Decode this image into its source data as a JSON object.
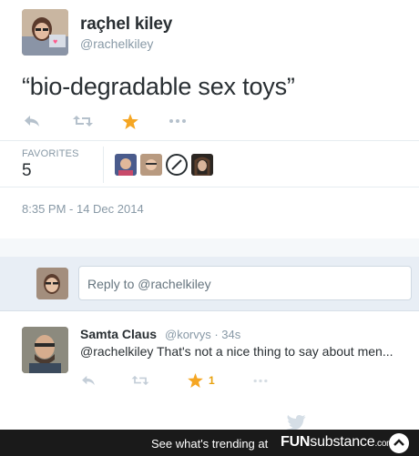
{
  "tweet": {
    "display_name": "raçhel kiley",
    "handle": "@rachelkiley",
    "text": "“bio-degradable sex toys”",
    "favorites_label": "FAVORITES",
    "favorites_count": "5",
    "timestamp": "8:35 PM - 14 Dec 2014",
    "action_icons": [
      "reply-icon",
      "retweet-icon",
      "favorite-star-icon",
      "more-dots-icon"
    ],
    "favorited_color": "#f5a623"
  },
  "reply_box": {
    "placeholder": "Reply to @rachelkiley"
  },
  "reply": {
    "display_name": "Samta Claus",
    "meta": "@korvys · 34s",
    "mention": "@rachelkiley",
    "body": " That's not a nice thing to say about men...",
    "favorite_count": "1"
  },
  "footer": {
    "cta": "See what's trending at",
    "brand_bold": "FUN",
    "brand_rest": "substance",
    "brand_suffix": ".com"
  },
  "colors": {
    "text_primary": "#292f33",
    "text_secondary": "#8899a6",
    "star": "#f5a623",
    "reply_band": "#e8eef5",
    "footer_bg": "#1a1a1a"
  }
}
